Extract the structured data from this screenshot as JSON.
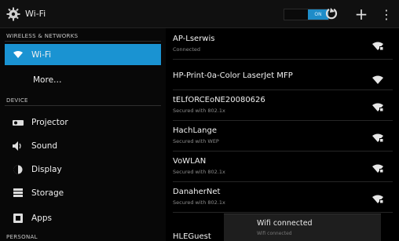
{
  "actionbar": {
    "title": "Wi-Fi",
    "toggle_label": "ON",
    "icons": [
      "settings-gear-icon",
      "wps-icon",
      "add-network-icon",
      "overflow-menu-icon"
    ],
    "add_glyph": "+",
    "overflow_glyph": "⋮"
  },
  "sidebar": {
    "sections": [
      {
        "header": "WIRELESS & NETWORKS"
      },
      {
        "header": "DEVICE"
      },
      {
        "header": "PERSONAL"
      }
    ],
    "items": [
      {
        "label": "Wi-Fi",
        "icon": "wifi-icon",
        "selected": true
      },
      {
        "label": "More…",
        "icon": ""
      },
      {
        "label": "Projector",
        "icon": "projector-icon"
      },
      {
        "label": "Sound",
        "icon": "speaker-icon"
      },
      {
        "label": "Display",
        "icon": "display-icon"
      },
      {
        "label": "Storage",
        "icon": "storage-icon"
      },
      {
        "label": "Apps",
        "icon": "apps-icon"
      }
    ]
  },
  "networks": [
    {
      "name": "AP-Lserwis",
      "status": "Connected",
      "signal_icon": "wifi-signal-icon"
    },
    {
      "name": "HP-Print-0a-Color LaserJet MFP",
      "status": "",
      "signal_icon": "wifi-signal-icon"
    },
    {
      "name": "tELfORCEoNE20080626",
      "status": "Secured with 802.1x",
      "signal_icon": "wifi-locked-icon"
    },
    {
      "name": "HachLange",
      "status": "Secured with WEP",
      "signal_icon": "wifi-locked-icon"
    },
    {
      "name": "VoWLAN",
      "status": "Secured with 802.1x",
      "signal_icon": "wifi-locked-icon"
    },
    {
      "name": "DanaherNet",
      "status": "Secured with 802.1x",
      "signal_icon": "wifi-locked-icon"
    },
    {
      "name": "HLEGuest",
      "status": "",
      "signal_icon": ""
    }
  ],
  "toast": {
    "title": "Wifi connected",
    "subtitle": "Wifi connected"
  },
  "colors": {
    "accent": "#1a93d2",
    "toggle_on": "#1e8cc8",
    "background": "#000000"
  }
}
